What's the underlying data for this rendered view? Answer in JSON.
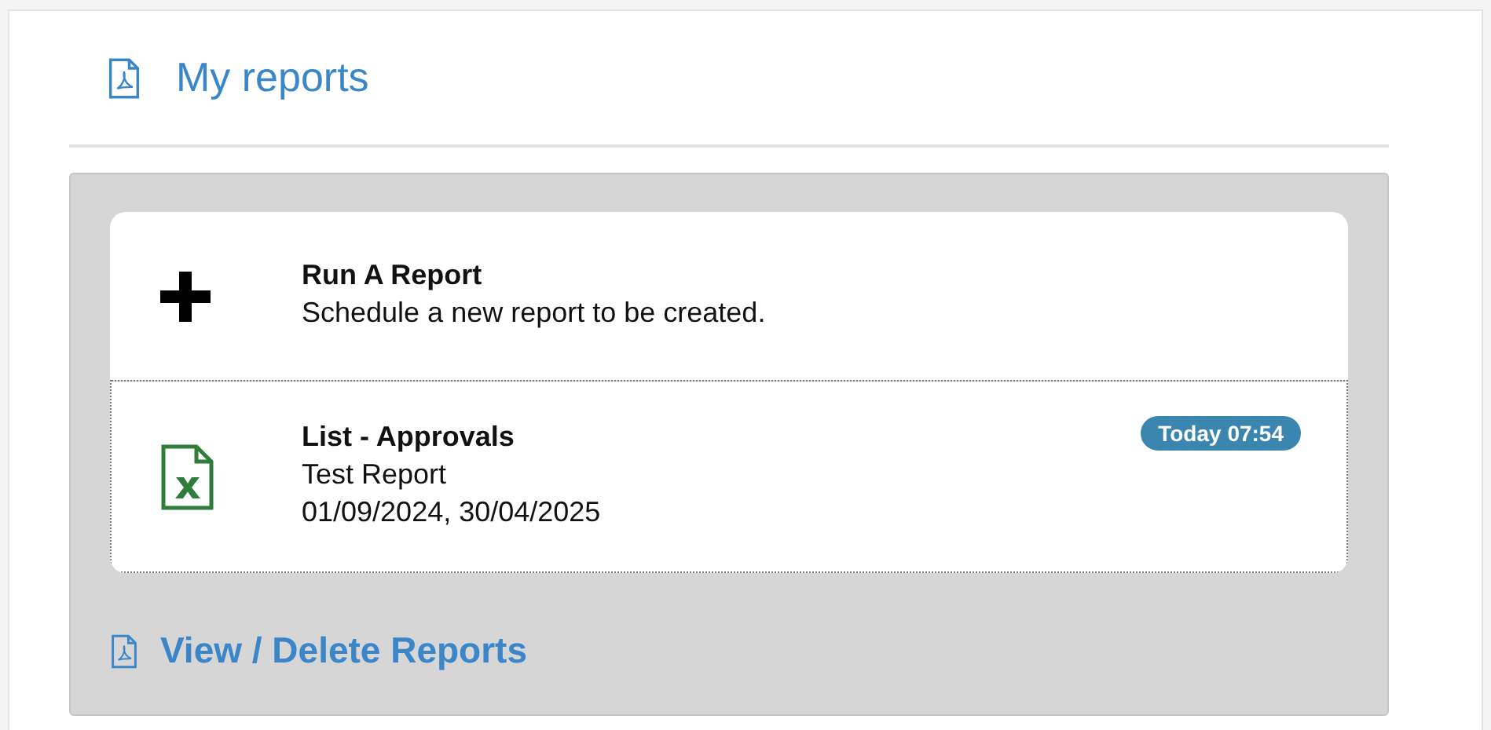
{
  "header": {
    "title": "My reports"
  },
  "items": [
    {
      "kind": "action",
      "title": "Run A Report",
      "lines": [
        "Schedule a new report to be created."
      ],
      "focused": false
    },
    {
      "kind": "report",
      "title": "List - Approvals",
      "lines": [
        "Test Report",
        "01/09/2024, 30/04/2025"
      ],
      "badge": "Today 07:54",
      "focused": true
    }
  ],
  "footer_link": "View / Delete Reports"
}
